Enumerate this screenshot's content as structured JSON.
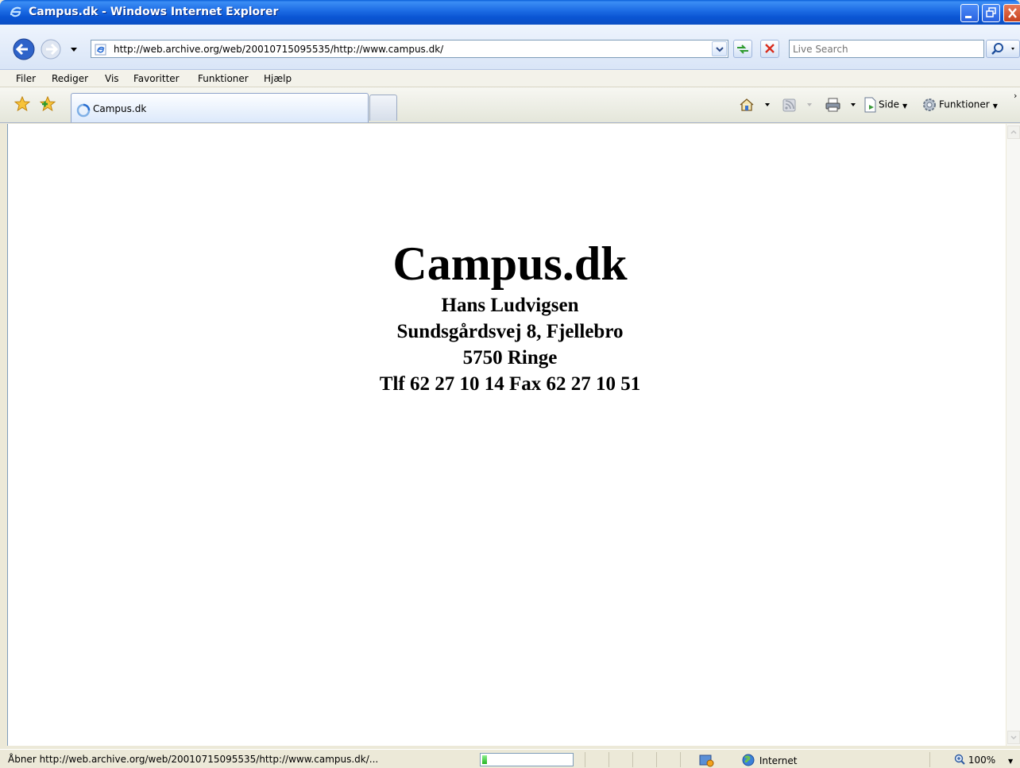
{
  "window": {
    "title": "Campus.dk - Windows Internet Explorer"
  },
  "address": {
    "url": "http://web.archive.org/web/20010715095535/http://www.campus.dk/"
  },
  "search": {
    "placeholder": "Live Search"
  },
  "menu": {
    "items": [
      "Filer",
      "Rediger",
      "Vis",
      "Favoritter",
      "Funktioner",
      "Hjælp"
    ]
  },
  "tab": {
    "label": "Campus.dk"
  },
  "commandbar": {
    "page_label": "Side",
    "tools_label": "Funktioner"
  },
  "page": {
    "heading": "Campus.dk",
    "lines": [
      "Hans Ludvigsen",
      "Sundsgårdsvej 8, Fjellebro",
      "5750 Ringe",
      "Tlf 62 27 10 14 Fax 62 27 10 51"
    ]
  },
  "status": {
    "text": "Åbner http://web.archive.org/web/20010715095535/http://www.campus.dk/...",
    "progress": 0.05,
    "zone": "Internet",
    "zoom": "100%"
  },
  "colors": {
    "title_bar": "#0a55d4",
    "close_button": "#c6421e",
    "progress_fill": "#23b523"
  },
  "icons": [
    "ie-logo-icon",
    "back-icon",
    "forward-icon",
    "refresh-icon",
    "stop-icon",
    "search-icon",
    "favorites-star-icon",
    "add-favorites-icon",
    "loading-spinner-icon",
    "home-icon",
    "feeds-icon",
    "print-icon",
    "page-icon",
    "tools-gear-icon",
    "protected-mode-icon",
    "internet-globe-icon",
    "zoom-icon"
  ]
}
